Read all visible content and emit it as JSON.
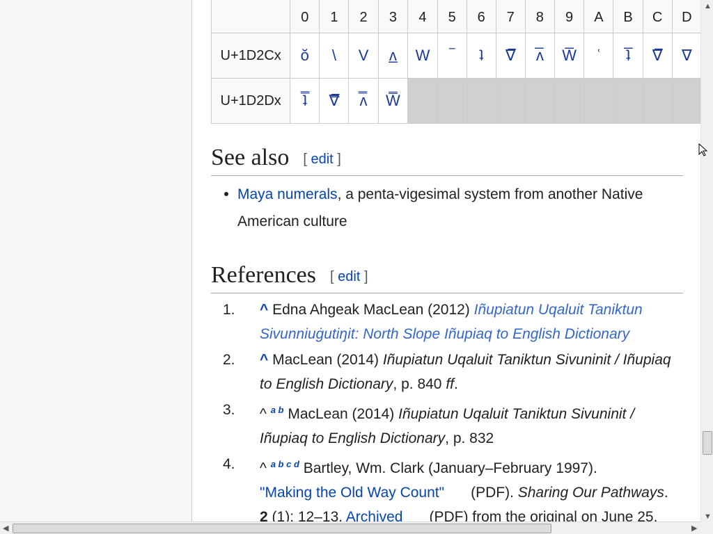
{
  "table": {
    "header": [
      "0",
      "1",
      "2",
      "3",
      "4",
      "5",
      "6",
      "7",
      "8",
      "9",
      "A",
      "B",
      "C",
      "D"
    ],
    "rows": [
      {
        "label": "U+1D2Cx",
        "cells": [
          "ŏ",
          "\\",
          "V",
          "ʌ̲",
          "W",
          "‾",
          "ʇ",
          "∇̅",
          "ʌ̅",
          "W̅",
          "ʿ",
          "ʇ̅",
          "∇̅̅",
          "∇"
        ]
      },
      {
        "label": "U+1D2Dx",
        "cells": [
          "ʇ̿",
          "∇̿",
          "ʌ̿",
          "W̿",
          "",
          "",
          "",
          "",
          "",
          "",
          "",
          "",
          "",
          ""
        ]
      }
    ]
  },
  "see_also": {
    "heading": "See also",
    "edit_open": "[",
    "edit_label": "edit",
    "edit_close": "]",
    "item_link": "Maya numerals",
    "item_text": ", a penta-vigesimal system from another Native American culture"
  },
  "references": {
    "heading": "References",
    "edit_open": "[",
    "edit_label": "edit",
    "edit_close": "]",
    "items": [
      {
        "num": "1.",
        "caret": "^",
        "author": " Edna Ahgeak MacLean (2012) ",
        "title_link": "Iñupiatun Uqaluit Taniktun Sivunniuġutiŋit: North Slope Iñupiaq to English Dictionary"
      },
      {
        "num": "2.",
        "caret": "^",
        "author": " MacLean (2014) ",
        "title": "Iñupiatun Uqaluit Taniktun Sivuninit / Iñupiaq to English Dictionary",
        "page": ", p. 840 ",
        "ff": "ff",
        "end": "."
      },
      {
        "num": "3.",
        "caret": "^",
        "sups": "a b",
        "author": " MacLean (2014) ",
        "title": "Iñupiatun Uqaluit Taniktun Sivuninit / Iñupiaq to English Dictionary",
        "page": ", p. 832"
      },
      {
        "num": "4.",
        "caret": "^",
        "sups": "a b c d",
        "author": " Bartley, Wm. Clark (January–February 1997).",
        "link": "\"Making the Old Way Count\"",
        "pdf": "(PDF).",
        "journal": "Sharing Our Pathways",
        "journal_end": ".",
        "vol": "2",
        "issue": " (1): 12–13. ",
        "archived": "Archived",
        "pdf2": "(PDF) from the original on June 25,"
      }
    ]
  }
}
